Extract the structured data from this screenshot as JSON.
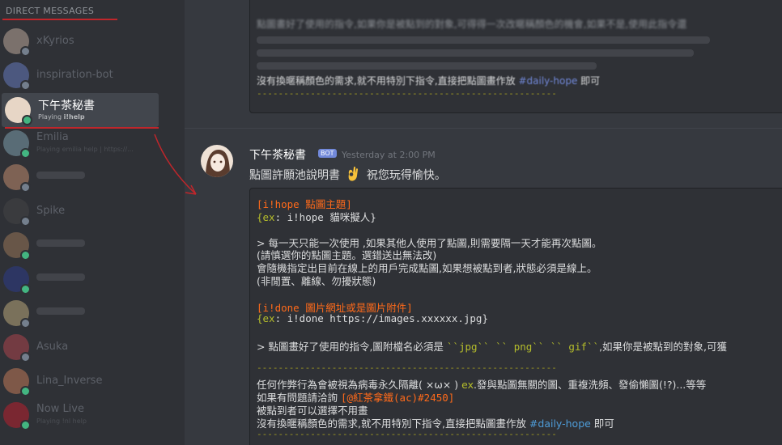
{
  "sidebar": {
    "header": "DIRECT MESSAGES",
    "items": [
      {
        "name": "xKyrios",
        "sub": "",
        "status": "offline",
        "active": false,
        "avatar_color": "#d9c2b0"
      },
      {
        "name": "inspiration-bot",
        "sub": "",
        "status": "offline",
        "active": false,
        "avatar_color": "#7289da"
      },
      {
        "name": "下午茶秘書",
        "sub_prefix": "Playing ",
        "sub_bold": "i!help",
        "status": "online",
        "active": true,
        "avatar_color": "#e7d6c6"
      },
      {
        "name": "Emilia",
        "sub": "Playing emilia help | https://...",
        "status": "online",
        "active": false,
        "avatar_color": "#8fb5c6"
      },
      {
        "name": "",
        "sub": "",
        "status": "offline",
        "active": false,
        "avatar_color": "#e0a07a"
      },
      {
        "name": "Spike",
        "sub": "",
        "status": "offline",
        "active": false,
        "avatar_color": "#4a4a4a"
      },
      {
        "name": "",
        "sub": "",
        "status": "online",
        "active": false,
        "avatar_color": "#b08660"
      },
      {
        "name": "",
        "sub": "",
        "status": "online",
        "active": false,
        "avatar_color": "#2c3e9c"
      },
      {
        "name": "",
        "sub": "",
        "status": "offline",
        "active": false,
        "avatar_color": "#d8c08a"
      },
      {
        "name": "Asuka",
        "sub": "",
        "status": "offline",
        "active": false,
        "avatar_color": "#c84a52"
      },
      {
        "name": "Lina_Inverse",
        "sub": "",
        "status": "online",
        "active": false,
        "avatar_color": "#e08a60"
      },
      {
        "name": "Now Live",
        "sub": "Playing !nl help",
        "status": "online",
        "active": false,
        "avatar_color": "#d81c2c"
      }
    ]
  },
  "previous_embed": {
    "line_a": "點圖畫好了使用的指令,如果你是被點到的對象,可得得一次改暱稱顏色的機會,如果不是,使用此指令還",
    "line_mention_prefix": "沒有換暱稱顏色的需求,就不用特別下指令,直接把點圖畫作放",
    "line_mention": "#daily-hope",
    "line_mention_suffix": "即可",
    "dashes": "--------------------------------------------------------"
  },
  "message": {
    "username": "下午茶秘書",
    "bot_tag": "BOT",
    "timestamp": "Yesterday at 2:00 PM",
    "text_before": "點圖許願池說明書",
    "text_after": "祝您玩得愉快。",
    "emoji_icon": "ok-hand-emoji-icon"
  },
  "codeblock": {
    "l1": "[i!hope 點圖主題]",
    "l2_a": "{ex",
    "l2_b": ": i!hope 貓咪擬人}",
    "l3": ">  每一天只能一次使用 ,如果其他人使用了點圖,則需要隔一天才能再次點圖。",
    "l4": "(請慎選你的點圖主題。選錯送出無法改)",
    "l5": "會隨機指定出目前在線上的用戶完成點圖,如果想被點到者,狀態必須是線上。",
    "l6": "(非閒置、離線、勿擾狀態)",
    "l7": "[i!done 圖片網址或是圖片附件]",
    "l8_a": "{ex",
    "l8_b": ": i!done https://images.xxxxxx.jpg}",
    "l9_a": ">  點圖畫好了使用的指令,圖附檔名必須是 ",
    "l9_b": "``jpg`` `` png`` `` gif``",
    "l9_c": ",如果你是被點到的對象,可獲",
    "dashes": "--------------------------------------------------------",
    "l10_a": "任何作弊行為會被視為病毒永久隔離( ×ω× ) ",
    "l10_b": "ex",
    "l10_c": ".發與點圖無關的圖、重複洗頻、發偷懶圖(!?)...等等",
    "l11_a": "如果有問題請洽詢 ",
    "l11_b": "[@紅茶拿鐵(ac)#2450]",
    "l12": "被點到者可以選擇不用畫",
    "l13_a": "沒有換暱稱顏色的需求,就不用特別下指令,直接把點圖畫作放 ",
    "l13_b": "#daily-hope",
    "l13_c": " 即可",
    "dashes2": "--------------------------------------------------------"
  },
  "colors": {
    "sidebar_bg": "#2f3136",
    "chat_bg": "#36393f",
    "annotation_red": "#c0262b",
    "online": "#43b581",
    "offline": "#747f8d",
    "bot_tag": "#7289da"
  }
}
